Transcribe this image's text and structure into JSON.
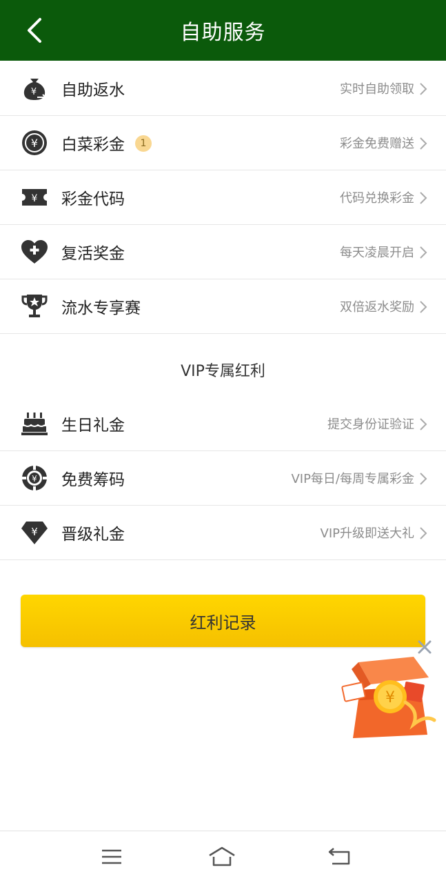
{
  "header": {
    "title": "自助服务",
    "back_icon": "chevron-left-icon"
  },
  "self_service": [
    {
      "icon": "money-bag-icon",
      "label": "自助返水",
      "desc": "实时自助领取"
    },
    {
      "icon": "yuan-coin-icon",
      "label": "白菜彩金",
      "badge": "1",
      "desc": "彩金免费赠送"
    },
    {
      "icon": "ticket-icon",
      "label": "彩金代码",
      "desc": "代码兑换彩金"
    },
    {
      "icon": "heart-plus-icon",
      "label": "复活奖金",
      "desc": "每天凌晨开启"
    },
    {
      "icon": "trophy-icon",
      "label": "流水专享赛",
      "desc": "双倍返水奖励"
    }
  ],
  "vip_section": {
    "title": "VIP专属红利",
    "items": [
      {
        "icon": "birthday-cake-icon",
        "label": "生日礼金",
        "desc": "提交身份证验证"
      },
      {
        "icon": "poker-chip-icon",
        "label": "免费筹码",
        "desc": "VIP每日/每周专属彩金"
      },
      {
        "icon": "diamond-yuan-icon",
        "label": "晋级礼金",
        "desc": "VIP升级即送大礼"
      }
    ]
  },
  "cta": {
    "label": "红利记录"
  },
  "floating_gift": {
    "icon": "gift-box-icon",
    "close_icon": "close-icon"
  },
  "nav": {
    "menu_icon": "menu-icon",
    "home_icon": "home-icon",
    "back_icon": "back-arrow-icon"
  },
  "colors": {
    "header": "#0b5a0b",
    "cta": "#ffd600",
    "badge": "#f9d791"
  }
}
